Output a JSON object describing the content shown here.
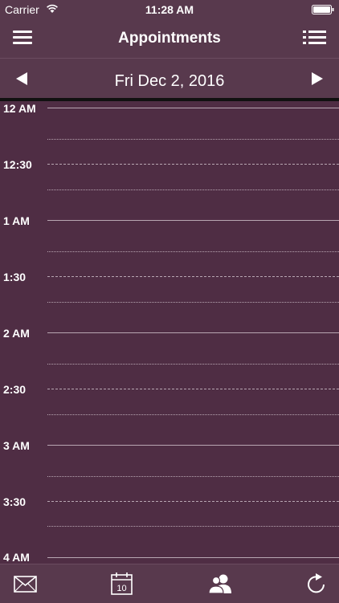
{
  "status_bar": {
    "carrier": "Carrier",
    "time": "11:28 AM"
  },
  "nav": {
    "title": "Appointments",
    "left_icon": "hamburger-menu-icon",
    "right_icon": "list-icon"
  },
  "date_bar": {
    "date": "Fri Dec 2, 2016",
    "prev_icon": "left-arrow-icon",
    "next_icon": "right-arrow-icon"
  },
  "schedule": {
    "slots": [
      "12 AM",
      "12:30",
      "1 AM",
      "1:30",
      "2 AM",
      "2:30",
      "3 AM",
      "3:30",
      "4 AM"
    ]
  },
  "tab_bar": {
    "items": [
      {
        "icon": "envelope-icon"
      },
      {
        "icon": "calendar-icon",
        "badge": "10"
      },
      {
        "icon": "contacts-icon"
      },
      {
        "icon": "refresh-icon"
      }
    ]
  },
  "colors": {
    "background": "#4f2d44",
    "bar": "#58394d",
    "text": "#ffffff",
    "grid_line": "#b8a6b2"
  }
}
